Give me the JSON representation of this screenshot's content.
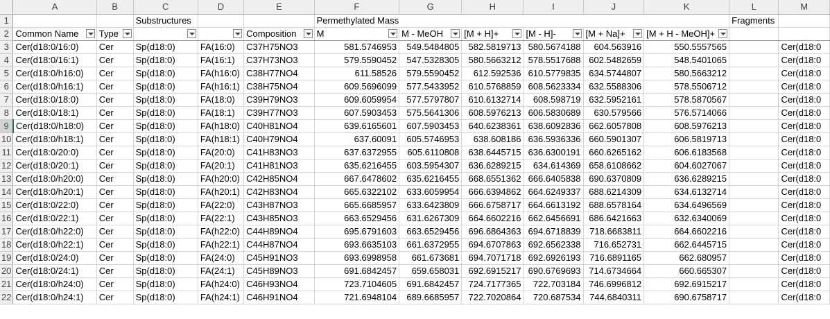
{
  "columns": [
    "A",
    "B",
    "C",
    "D",
    "E",
    "F",
    "G",
    "H",
    "I",
    "J",
    "K",
    "L",
    "M"
  ],
  "group_row": {
    "row_number": "1",
    "substructures": "Substructures",
    "permethylated_mass": "Permethylated Mass",
    "fragments": "Fragments"
  },
  "header_row": {
    "row_number": "2",
    "cells": [
      "Common Name",
      "Type",
      "",
      "",
      "Composition",
      "M",
      "M - MeOH",
      "[M + H]+",
      "[M - H]-",
      "[M + Na]+",
      "[M + H - MeOH]+",
      "",
      ""
    ]
  },
  "filter_icon": "dropdown-filter-icon",
  "selected_row_color": "#217346",
  "rows": [
    {
      "n": "3",
      "c": [
        "Cer(d18:0/16:0)",
        "Cer",
        "Sp(d18:0)",
        "FA(16:0)",
        "C37H75NO3",
        "581.5746953",
        "549.5484805",
        "582.5819713",
        "580.5674188",
        "604.563916",
        "550.5557565",
        "",
        "Cer(d18:0"
      ]
    },
    {
      "n": "4",
      "c": [
        "Cer(d18:0/16:1)",
        "Cer",
        "Sp(d18:0)",
        "FA(16:1)",
        "C37H73NO3",
        "579.5590452",
        "547.5328305",
        "580.5663212",
        "578.5517688",
        "602.5482659",
        "548.5401065",
        "",
        "Cer(d18:0"
      ]
    },
    {
      "n": "5",
      "c": [
        "Cer(d18:0/h16:0)",
        "Cer",
        "Sp(d18:0)",
        "FA(h16:0)",
        "C38H77NO4",
        "611.58526",
        "579.5590452",
        "612.592536",
        "610.5779835",
        "634.5744807",
        "580.5663212",
        "",
        "Cer(d18:0"
      ]
    },
    {
      "n": "6",
      "c": [
        "Cer(d18:0/h16:1)",
        "Cer",
        "Sp(d18:0)",
        "FA(h16:1)",
        "C38H75NO4",
        "609.5696099",
        "577.5433952",
        "610.5768859",
        "608.5623334",
        "632.5588306",
        "578.5506712",
        "",
        "Cer(d18:0"
      ]
    },
    {
      "n": "7",
      "c": [
        "Cer(d18:0/18:0)",
        "Cer",
        "Sp(d18:0)",
        "FA(18:0)",
        "C39H79NO3",
        "609.6059954",
        "577.5797807",
        "610.6132714",
        "608.598719",
        "632.5952161",
        "578.5870567",
        "",
        "Cer(d18:0"
      ]
    },
    {
      "n": "8",
      "c": [
        "Cer(d18:0/18:1)",
        "Cer",
        "Sp(d18:0)",
        "FA(18:1)",
        "C39H77NO3",
        "607.5903453",
        "575.5641306",
        "608.5976213",
        "606.5830689",
        "630.579566",
        "576.5714066",
        "",
        "Cer(d18:0"
      ]
    },
    {
      "n": "9",
      "c": [
        "Cer(d18:0/h18:0)",
        "Cer",
        "Sp(d18:0)",
        "FA(h18:0)",
        "C40H81NO4",
        "639.6165601",
        "607.5903453",
        "640.6238361",
        "638.6092836",
        "662.6057808",
        "608.5976213",
        "",
        "Cer(d18:0"
      ]
    },
    {
      "n": "10",
      "c": [
        "Cer(d18:0/h18:1)",
        "Cer",
        "Sp(d18:0)",
        "FA(h18:1)",
        "C40H79NO4",
        "637.60091",
        "605.5746953",
        "638.608186",
        "636.5936336",
        "660.5901307",
        "606.5819713",
        "",
        "Cer(d18:0"
      ]
    },
    {
      "n": "11",
      "c": [
        "Cer(d18:0/20:0)",
        "Cer",
        "Sp(d18:0)",
        "FA(20:0)",
        "C41H83NO3",
        "637.6372955",
        "605.6110808",
        "638.6445715",
        "636.6300191",
        "660.6265162",
        "606.6183568",
        "",
        "Cer(d18:0"
      ]
    },
    {
      "n": "12",
      "c": [
        "Cer(d18:0/20:1)",
        "Cer",
        "Sp(d18:0)",
        "FA(20:1)",
        "C41H81NO3",
        "635.6216455",
        "603.5954307",
        "636.6289215",
        "634.614369",
        "658.6108662",
        "604.6027067",
        "",
        "Cer(d18:0"
      ]
    },
    {
      "n": "13",
      "c": [
        "Cer(d18:0/h20:0)",
        "Cer",
        "Sp(d18:0)",
        "FA(h20:0)",
        "C42H85NO4",
        "667.6478602",
        "635.6216455",
        "668.6551362",
        "666.6405838",
        "690.6370809",
        "636.6289215",
        "",
        "Cer(d18:0"
      ]
    },
    {
      "n": "14",
      "c": [
        "Cer(d18:0/h20:1)",
        "Cer",
        "Sp(d18:0)",
        "FA(h20:1)",
        "C42H83NO4",
        "665.6322102",
        "633.6059954",
        "666.6394862",
        "664.6249337",
        "688.6214309",
        "634.6132714",
        "",
        "Cer(d18:0"
      ]
    },
    {
      "n": "15",
      "c": [
        "Cer(d18:0/22:0)",
        "Cer",
        "Sp(d18:0)",
        "FA(22:0)",
        "C43H87NO3",
        "665.6685957",
        "633.6423809",
        "666.6758717",
        "664.6613192",
        "688.6578164",
        "634.6496569",
        "",
        "Cer(d18:0"
      ]
    },
    {
      "n": "16",
      "c": [
        "Cer(d18:0/22:1)",
        "Cer",
        "Sp(d18:0)",
        "FA(22:1)",
        "C43H85NO3",
        "663.6529456",
        "631.6267309",
        "664.6602216",
        "662.6456691",
        "686.6421663",
        "632.6340069",
        "",
        "Cer(d18:0"
      ]
    },
    {
      "n": "17",
      "c": [
        "Cer(d18:0/h22:0)",
        "Cer",
        "Sp(d18:0)",
        "FA(h22:0)",
        "C44H89NO4",
        "695.6791603",
        "663.6529456",
        "696.6864363",
        "694.6718839",
        "718.6683811",
        "664.6602216",
        "",
        "Cer(d18:0"
      ]
    },
    {
      "n": "18",
      "c": [
        "Cer(d18:0/h22:1)",
        "Cer",
        "Sp(d18:0)",
        "FA(h22:1)",
        "C44H87NO4",
        "693.6635103",
        "661.6372955",
        "694.6707863",
        "692.6562338",
        "716.652731",
        "662.6445715",
        "",
        "Cer(d18:0"
      ]
    },
    {
      "n": "19",
      "c": [
        "Cer(d18:0/24:0)",
        "Cer",
        "Sp(d18:0)",
        "FA(24:0)",
        "C45H91NO3",
        "693.6998958",
        "661.673681",
        "694.7071718",
        "692.6926193",
        "716.6891165",
        "662.680957",
        "",
        "Cer(d18:0"
      ]
    },
    {
      "n": "20",
      "c": [
        "Cer(d18:0/24:1)",
        "Cer",
        "Sp(d18:0)",
        "FA(24:1)",
        "C45H89NO3",
        "691.6842457",
        "659.658031",
        "692.6915217",
        "690.6769693",
        "714.6734664",
        "660.665307",
        "",
        "Cer(d18:0"
      ]
    },
    {
      "n": "21",
      "c": [
        "Cer(d18:0/h24:0)",
        "Cer",
        "Sp(d18:0)",
        "FA(h24:0)",
        "C46H93NO4",
        "723.7104605",
        "691.6842457",
        "724.7177365",
        "722.703184",
        "746.6996812",
        "692.6915217",
        "",
        "Cer(d18:0"
      ]
    },
    {
      "n": "22",
      "c": [
        "Cer(d18:0/h24:1)",
        "Cer",
        "Sp(d18:0)",
        "FA(h24:1)",
        "C46H91NO4",
        "721.6948104",
        "689.6685957",
        "722.7020864",
        "720.687534",
        "744.6840311",
        "690.6758717",
        "",
        "Cer(d18:0"
      ]
    }
  ]
}
